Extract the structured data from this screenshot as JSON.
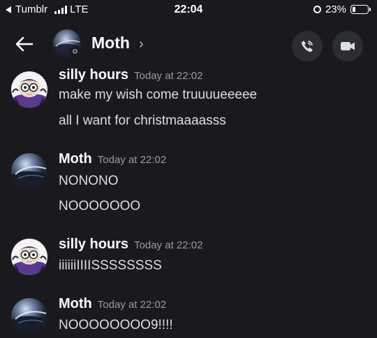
{
  "status_bar": {
    "back_app": "Tumblr",
    "network": "LTE",
    "time": "22:04",
    "battery_percent": "23%",
    "battery_level": 0.23
  },
  "header": {
    "channel_name": "Moth",
    "chevron": "›",
    "icons": [
      "back-arrow-icon",
      "phone-icon",
      "video-camera-icon"
    ]
  },
  "messages": [
    {
      "author": "silly hours",
      "timestamp": "Today at 22:02",
      "lines": [
        "make my wish come truuuueeeee",
        "all I want for christmaaaasss"
      ]
    },
    {
      "author": "Moth",
      "timestamp": "Today at 22:02",
      "lines": [
        "NONONO",
        "NOOOOOOO"
      ]
    },
    {
      "author": "silly hours",
      "timestamp": "Today at 22:02",
      "lines": [
        "iiiiiiIIIISSSSSSSS"
      ]
    },
    {
      "author": "Moth",
      "timestamp": "Today at 22:02",
      "lines": [
        "NOOOOOOOO9!!!!"
      ]
    }
  ],
  "colors": {
    "background": "#1a1a1e",
    "button_bg": "#2b2d31",
    "timestamp": "#949ba4",
    "text": "#dbdee1"
  }
}
